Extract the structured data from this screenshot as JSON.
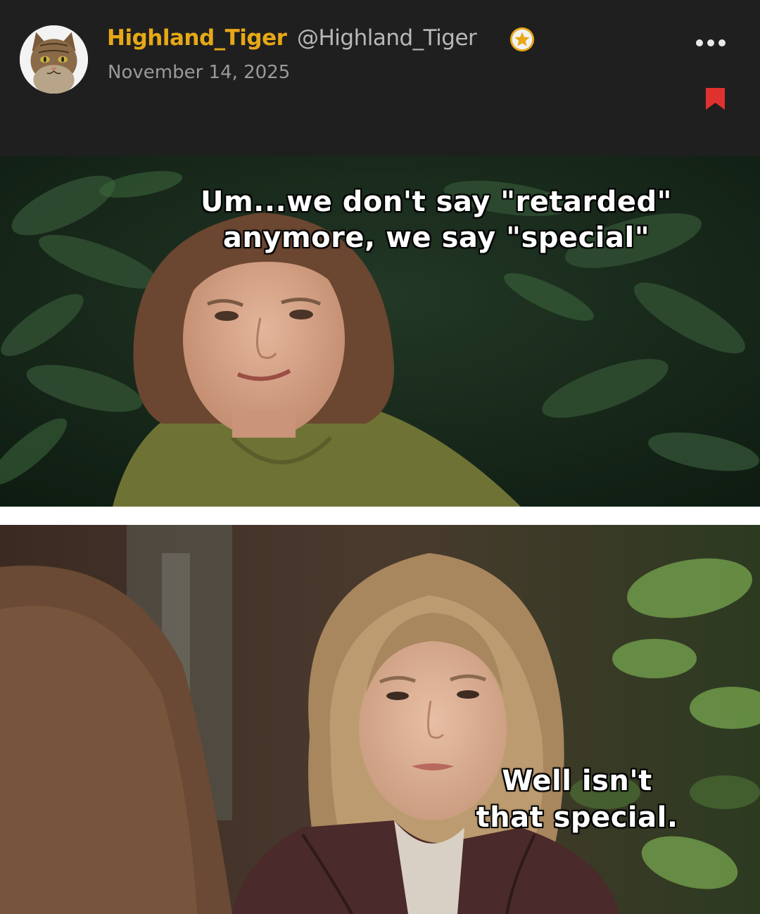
{
  "post": {
    "author_name": "Highland_Tiger",
    "author_handle": "@Highland_Tiger",
    "date": "November 14, 2025",
    "verified_icon": "star-badge-icon",
    "more_icon": "more-options-icon",
    "bookmark_icon": "bookmark-icon",
    "colors": {
      "name": "#e6a817",
      "handle": "#b8b8b8",
      "date": "#9a9a9a",
      "background": "#1f1f1f",
      "bookmark": "#e0312f",
      "badge": "#e6a817"
    }
  },
  "meme": {
    "top_caption_line1": "Um...we don't say \"retarded\"",
    "top_caption_line2": "anymore, we say \"special\"",
    "bottom_caption_line1": "Well isn't",
    "bottom_caption_line2": "that special."
  }
}
